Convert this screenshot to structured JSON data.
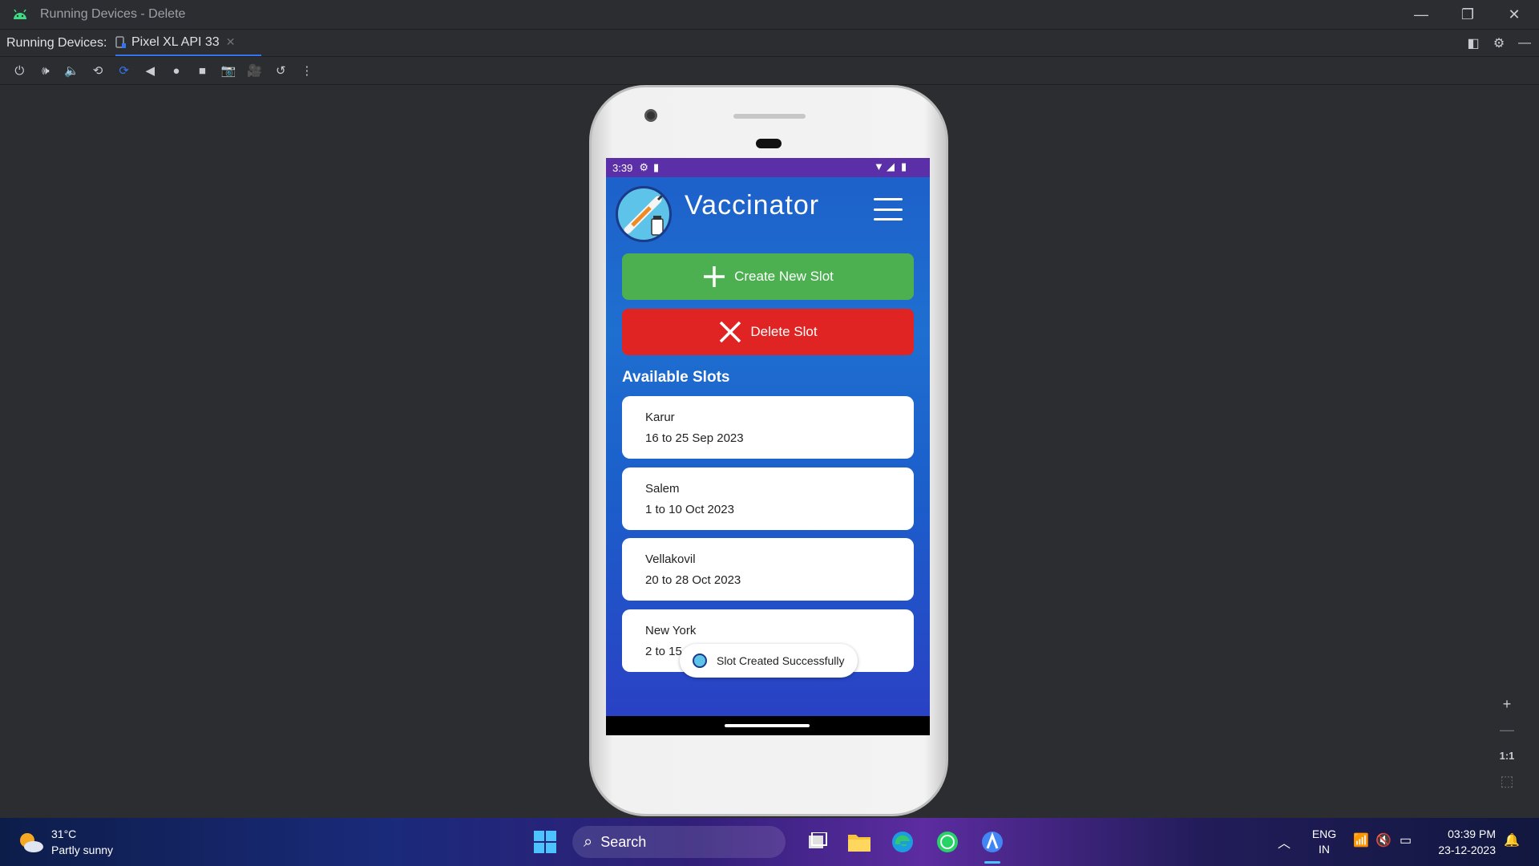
{
  "window": {
    "title": "Running Devices - Delete",
    "controls": [
      "minimize",
      "restore",
      "close"
    ]
  },
  "tabbar": {
    "label": "Running Devices:",
    "tab_label": "Pixel XL API 33"
  },
  "toolbar": {
    "icons": [
      "power-icon",
      "volume-up-icon",
      "volume-down-icon",
      "rotate-left-icon",
      "rotate-right-icon",
      "back-icon",
      "home-icon",
      "overview-icon",
      "screenshot-icon",
      "screen-record-icon",
      "snapshot-icon",
      "more-icon"
    ]
  },
  "phone": {
    "status": {
      "time": "3:39"
    },
    "app": {
      "title": "Vaccinator",
      "create_label": "Create New Slot",
      "delete_label": "Delete Slot",
      "section_title": "Available Slots",
      "colors": {
        "create": "#43a047",
        "delete": "#e02424",
        "status_bar": "#5b2fa8"
      },
      "slots": [
        {
          "place": "Karur",
          "dates": "16 to 25 Sep 2023"
        },
        {
          "place": "Salem",
          "dates": "1 to 10 Oct 2023"
        },
        {
          "place": "Vellakovil",
          "dates": "20 to 28 Oct 2023"
        },
        {
          "place": "New York",
          "dates": "2 to 15"
        }
      ],
      "toast": "Slot Created Successfully"
    }
  },
  "zoom": {
    "one_to_one": "1:1"
  },
  "taskbar": {
    "weather_temp": "31°C",
    "weather_desc": "Partly sunny",
    "search_label": "Search",
    "lang_line1": "ENG",
    "lang_line2": "IN",
    "time": "03:39 PM",
    "date": "23-12-2023"
  }
}
